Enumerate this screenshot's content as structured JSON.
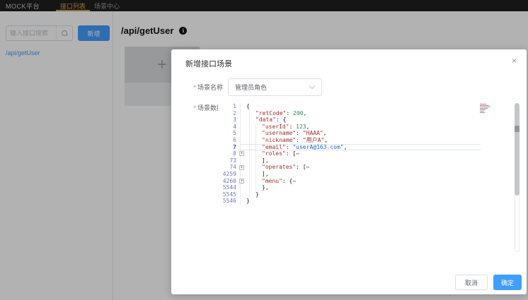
{
  "navbar": {
    "brand": "MOCK平台",
    "tabs": [
      {
        "label": "接口列表",
        "active": true
      },
      {
        "label": "场景中心",
        "active": false
      }
    ]
  },
  "sidebar": {
    "search_placeholder": "输入接口搜索",
    "add_button": "新增",
    "api_items": [
      {
        "label": "/api/getUser"
      }
    ]
  },
  "main": {
    "title": "/api/getUser",
    "info_icon": "i",
    "add_card_plus": "+"
  },
  "modal": {
    "title": "新增接口场景",
    "close_icon": "×",
    "fields": {
      "scene_name": {
        "label": "场景名称",
        "required_mark": "*",
        "value": "管理员角色"
      },
      "scene_data": {
        "label": "场景数据",
        "required_mark": "*"
      }
    },
    "editor": {
      "lines": [
        {
          "num": "1",
          "indent": 0,
          "segs": [
            [
              "p",
              "{"
            ]
          ]
        },
        {
          "num": "2",
          "indent": 1,
          "segs": [
            [
              "k",
              "\"retCode\""
            ],
            [
              "p",
              ": "
            ],
            [
              "n",
              "200"
            ],
            [
              "p",
              ","
            ]
          ]
        },
        {
          "num": "3",
          "indent": 1,
          "segs": [
            [
              "k",
              "\"data\""
            ],
            [
              "p",
              ": {"
            ]
          ]
        },
        {
          "num": "4",
          "indent": 2,
          "segs": [
            [
              "k",
              "\"userId\""
            ],
            [
              "p",
              ": "
            ],
            [
              "n",
              "123"
            ],
            [
              "p",
              ","
            ]
          ]
        },
        {
          "num": "5",
          "indent": 2,
          "segs": [
            [
              "k",
              "\"username\""
            ],
            [
              "p",
              ": "
            ],
            [
              "s",
              "\"HAAA\""
            ],
            [
              "p",
              ","
            ]
          ]
        },
        {
          "num": "6",
          "indent": 2,
          "segs": [
            [
              "k",
              "\"nickname\""
            ],
            [
              "p",
              ": "
            ],
            [
              "s",
              "\"用户A\""
            ],
            [
              "p",
              ","
            ]
          ]
        },
        {
          "num": "7",
          "indent": 2,
          "active": true,
          "segs": [
            [
              "k",
              "\"email\""
            ],
            [
              "p",
              ": "
            ],
            [
              "l",
              "\"userA@163.com\""
            ],
            [
              "p",
              ","
            ]
          ]
        },
        {
          "num": "8",
          "indent": 2,
          "fold": true,
          "segs": [
            [
              "k",
              "\"roles\""
            ],
            [
              "p",
              ": ["
            ],
            [
              "f",
              "↔"
            ]
          ]
        },
        {
          "num": "73",
          "indent": 2,
          "segs": [
            [
              "p",
              "],"
            ]
          ]
        },
        {
          "num": "74",
          "indent": 2,
          "fold": true,
          "segs": [
            [
              "k",
              "\"operates\""
            ],
            [
              "p",
              ": ["
            ],
            [
              "f",
              "↔"
            ]
          ]
        },
        {
          "num": "4259",
          "indent": 2,
          "segs": [
            [
              "p",
              "],"
            ]
          ]
        },
        {
          "num": "4260",
          "indent": 2,
          "fold": true,
          "segs": [
            [
              "k",
              "\"menu\""
            ],
            [
              "p",
              ": {"
            ],
            [
              "f",
              "↔"
            ]
          ]
        },
        {
          "num": "5544",
          "indent": 2,
          "segs": [
            [
              "p",
              "},"
            ]
          ]
        },
        {
          "num": "5545",
          "indent": 1,
          "segs": [
            [
              "p",
              "}"
            ]
          ]
        },
        {
          "num": "5546",
          "indent": 0,
          "segs": [
            [
              "p",
              "}"
            ]
          ]
        }
      ],
      "fold_icon": "+"
    },
    "footer": {
      "cancel": "取消",
      "confirm": "确定"
    }
  },
  "colors": {
    "accent": "#409eff",
    "nav_active_tab": "#d4a24e",
    "required_mark": "#f56c6c",
    "code_key_string": "#a03028",
    "code_number": "#28875a",
    "code_link": "#1a66cc",
    "line_number": "#7078c2"
  }
}
